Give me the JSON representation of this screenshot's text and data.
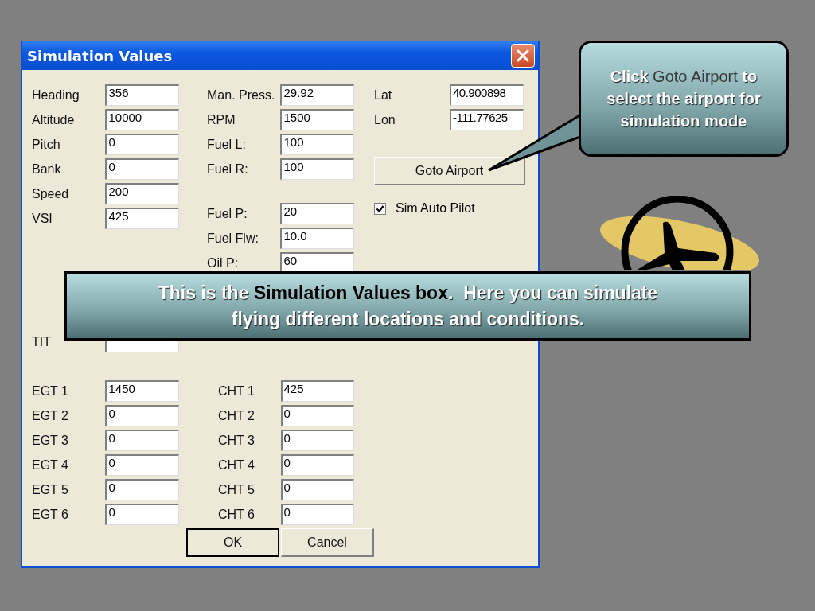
{
  "window": {
    "title": "Simulation Values"
  },
  "left_column": [
    [
      {
        "label": "Heading",
        "value": "356"
      },
      {
        "label": "Altitude",
        "value": "10000"
      },
      {
        "label": "Pitch",
        "value": "0"
      },
      {
        "label": "Bank",
        "value": "0"
      },
      {
        "label": "Speed",
        "value": "200"
      },
      {
        "label": "VSI",
        "value": "425"
      }
    ],
    [
      {
        "label": "TIT"
      }
    ],
    [
      {
        "label": "EGT 1",
        "value": "1450"
      },
      {
        "label": "EGT 2",
        "value": "0"
      },
      {
        "label": "EGT 3",
        "value": "0"
      },
      {
        "label": "EGT 4",
        "value": "0"
      },
      {
        "label": "EGT 5",
        "value": "0"
      },
      {
        "label": "EGT 6",
        "value": "0"
      }
    ]
  ],
  "middle_column": [
    [
      {
        "label": "Man. Press.",
        "value": "29.92"
      },
      {
        "label": "RPM",
        "value": "1500"
      },
      {
        "label": "Fuel L:",
        "value": "100"
      },
      {
        "label": "Fuel R:",
        "value": "100"
      }
    ],
    [
      {
        "label": "Fuel P:",
        "value": "20"
      },
      {
        "label": "Fuel Flw:",
        "value": "10.0"
      },
      {
        "label": "Oil P:",
        "value": "60"
      }
    ],
    [
      {
        "label": "CHT 1",
        "value": "425"
      },
      {
        "label": "CHT 2",
        "value": "0"
      },
      {
        "label": "CHT 3",
        "value": "0"
      },
      {
        "label": "CHT 4",
        "value": "0"
      },
      {
        "label": "CHT 5",
        "value": "0"
      },
      {
        "label": "CHT 6",
        "value": "0"
      }
    ]
  ],
  "location": [
    {
      "label": "Lat",
      "value": "40.900898"
    },
    {
      "label": "Lon",
      "value": "-111.77625"
    }
  ],
  "goto_button": "Goto Airport",
  "checkbox": {
    "label": "Sim Auto Pilot",
    "checked": true
  },
  "buttons": [
    {
      "label": "OK",
      "default": true
    },
    {
      "label": "Cancel",
      "default": false
    }
  ],
  "callouts": [
    {
      "kind": "pointer",
      "text": "Click **Goto Airport** to select the airport for simulation mode"
    },
    {
      "kind": "banner",
      "text": "This is the **Simulation Values box**.  Here you can simulate flying different locations and conditions."
    }
  ]
}
